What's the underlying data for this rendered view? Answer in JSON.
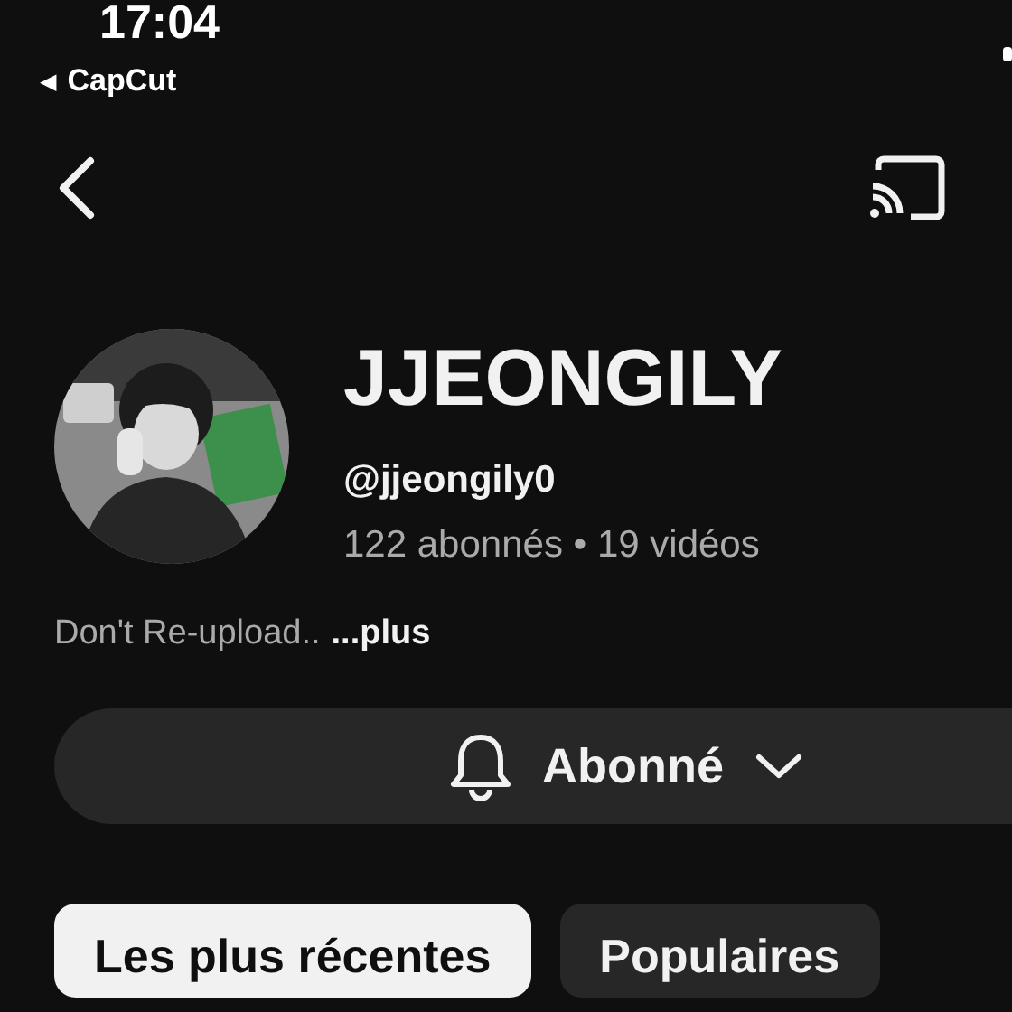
{
  "status_bar": {
    "time": "17:04",
    "back_app": "CapCut",
    "back_arrow": "◀"
  },
  "channel": {
    "name": "JJEONGILY",
    "handle": "@jjeongily0",
    "stats": "122 abonnés • 19 vidéos",
    "description": "Don't Re-upload..",
    "more": "...plus"
  },
  "subscribe_button": {
    "label": "Abonné"
  },
  "chips": [
    {
      "label": "Les plus récentes",
      "selected": true
    },
    {
      "label": "Populaires",
      "selected": false
    }
  ]
}
